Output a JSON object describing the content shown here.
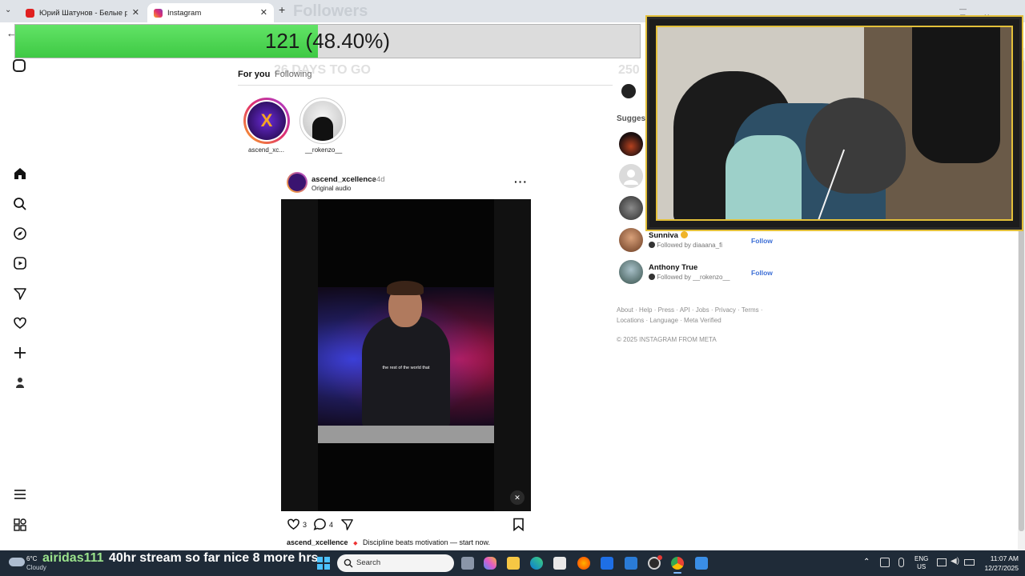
{
  "browser": {
    "tabs": [
      {
        "label": "Юрий Шатунов - Белые розы"
      },
      {
        "label": "Instagram"
      }
    ],
    "new_tab_symbol": "+"
  },
  "overlay": {
    "followers_title": "Followers",
    "progress_text": "121 (48.40%)",
    "progress_fraction": 0.484,
    "days_text": "26 DAYS TO GO",
    "goal_text": "250"
  },
  "feed": {
    "tabs": [
      "For you",
      "Following"
    ],
    "stories": [
      {
        "name": "ascend_xc..."
      },
      {
        "name": "__rokenzo__"
      }
    ],
    "post": {
      "username": "ascend_xcellence",
      "age": "4d",
      "audio": "Original audio",
      "video_caption": "the rest of the world that",
      "likes": "3",
      "comments": "4",
      "caption_user": "ascend_xcellence",
      "caption_text": "Discipline beats motivation — start now."
    }
  },
  "sidebar": {
    "suggested_label": "Suggested",
    "suggestions": [
      {
        "name": "Sunniva",
        "sub": "Followed by diaaana_fi",
        "action": "Follow"
      },
      {
        "name": "Anthony True",
        "sub": "Followed by __rokenzo__",
        "action": "Follow"
      }
    ],
    "footer_links_1": "About · Help · Press · API · Jobs · Privacy · Terms ·",
    "footer_links_2": "Locations · Language · Meta Verified",
    "copyright": "© 2025 INSTAGRAM FROM META"
  },
  "taskbar": {
    "temp": "6°C",
    "weather": "Cloudy",
    "ticker_user": "airidas111",
    "ticker_msg": "40hr stream so far nice 8 more hrs",
    "search_placeholder": "Search",
    "lang_1": "ENG",
    "lang_2": "US",
    "time": "11:07 AM",
    "date": "12/27/2025"
  }
}
